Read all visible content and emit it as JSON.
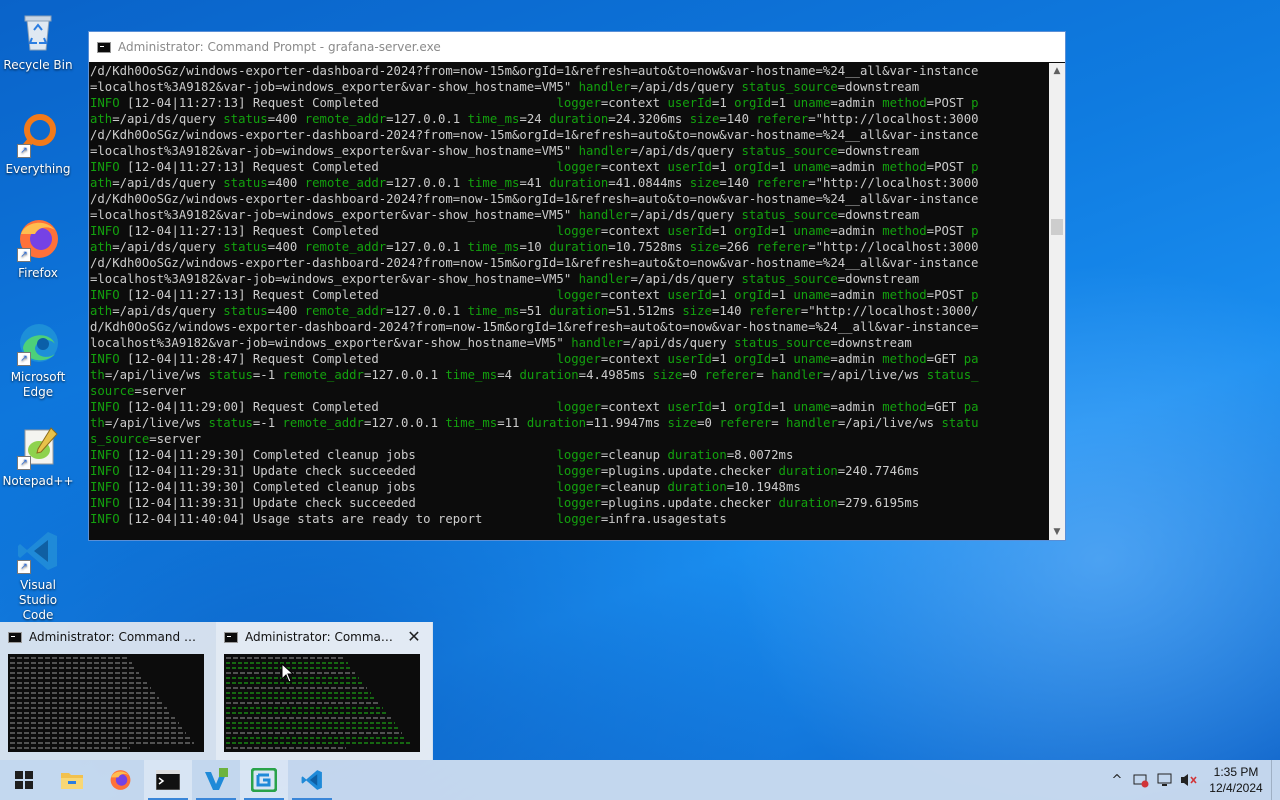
{
  "desktop": {
    "icons": [
      {
        "label": "Recycle Bin",
        "icon": "recycle-bin-icon"
      },
      {
        "label": "Everything",
        "icon": "search-magnifier-icon"
      },
      {
        "label": "Firefox",
        "icon": "firefox-icon"
      },
      {
        "label": "Microsoft Edge",
        "icon": "edge-icon"
      },
      {
        "label": "Notepad++",
        "icon": "notepadpp-icon"
      },
      {
        "label": "Visual Studio Code",
        "icon": "vscode-icon"
      }
    ]
  },
  "window": {
    "title": "Administrator: Command Prompt - grafana-server.exe",
    "console_lines": [
      [
        [
          "/d/Kdh0OoSGz/windows-exporter-dashboard-2024?from=now-15m&orgId=1&refresh=auto&to=now&var-hostname=%24__all&var-instance",
          "w"
        ]
      ],
      [
        [
          "=localhost%3A9182&var-job=windows_exporter&var-show_hostname=VM5\" ",
          "w"
        ],
        [
          "handler",
          "g"
        ],
        [
          "=/api/ds/query ",
          "w"
        ],
        [
          "status_source",
          "g"
        ],
        [
          "=downstream",
          "w"
        ]
      ],
      [
        [
          "INFO",
          "g"
        ],
        [
          " [12-04|11:27:13] Request Completed                        ",
          "w"
        ],
        [
          "logger",
          "g"
        ],
        [
          "=context ",
          "w"
        ],
        [
          "userId",
          "g"
        ],
        [
          "=1 ",
          "w"
        ],
        [
          "orgId",
          "g"
        ],
        [
          "=1 ",
          "w"
        ],
        [
          "uname",
          "g"
        ],
        [
          "=admin ",
          "w"
        ],
        [
          "method",
          "g"
        ],
        [
          "=POST ",
          "w"
        ],
        [
          "p",
          "g"
        ]
      ],
      [
        [
          "ath",
          "g"
        ],
        [
          "=/api/ds/query ",
          "w"
        ],
        [
          "status",
          "g"
        ],
        [
          "=400 ",
          "w"
        ],
        [
          "remote_addr",
          "g"
        ],
        [
          "=127.0.0.1 ",
          "w"
        ],
        [
          "time_ms",
          "g"
        ],
        [
          "=24 ",
          "w"
        ],
        [
          "duration",
          "g"
        ],
        [
          "=24.3206ms ",
          "w"
        ],
        [
          "size",
          "g"
        ],
        [
          "=140 ",
          "w"
        ],
        [
          "referer",
          "g"
        ],
        [
          "=\"http://localhost:3000",
          "w"
        ]
      ],
      [
        [
          "/d/Kdh0OoSGz/windows-exporter-dashboard-2024?from=now-15m&orgId=1&refresh=auto&to=now&var-hostname=%24__all&var-instance",
          "w"
        ]
      ],
      [
        [
          "=localhost%3A9182&var-job=windows_exporter&var-show_hostname=VM5\" ",
          "w"
        ],
        [
          "handler",
          "g"
        ],
        [
          "=/api/ds/query ",
          "w"
        ],
        [
          "status_source",
          "g"
        ],
        [
          "=downstream",
          "w"
        ]
      ],
      [
        [
          "INFO",
          "g"
        ],
        [
          " [12-04|11:27:13] Request Completed                        ",
          "w"
        ],
        [
          "logger",
          "g"
        ],
        [
          "=context ",
          "w"
        ],
        [
          "userId",
          "g"
        ],
        [
          "=1 ",
          "w"
        ],
        [
          "orgId",
          "g"
        ],
        [
          "=1 ",
          "w"
        ],
        [
          "uname",
          "g"
        ],
        [
          "=admin ",
          "w"
        ],
        [
          "method",
          "g"
        ],
        [
          "=POST ",
          "w"
        ],
        [
          "p",
          "g"
        ]
      ],
      [
        [
          "ath",
          "g"
        ],
        [
          "=/api/ds/query ",
          "w"
        ],
        [
          "status",
          "g"
        ],
        [
          "=400 ",
          "w"
        ],
        [
          "remote_addr",
          "g"
        ],
        [
          "=127.0.0.1 ",
          "w"
        ],
        [
          "time_ms",
          "g"
        ],
        [
          "=41 ",
          "w"
        ],
        [
          "duration",
          "g"
        ],
        [
          "=41.0844ms ",
          "w"
        ],
        [
          "size",
          "g"
        ],
        [
          "=140 ",
          "w"
        ],
        [
          "referer",
          "g"
        ],
        [
          "=\"http://localhost:3000",
          "w"
        ]
      ],
      [
        [
          "/d/Kdh0OoSGz/windows-exporter-dashboard-2024?from=now-15m&orgId=1&refresh=auto&to=now&var-hostname=%24__all&var-instance",
          "w"
        ]
      ],
      [
        [
          "=localhost%3A9182&var-job=windows_exporter&var-show_hostname=VM5\" ",
          "w"
        ],
        [
          "handler",
          "g"
        ],
        [
          "=/api/ds/query ",
          "w"
        ],
        [
          "status_source",
          "g"
        ],
        [
          "=downstream",
          "w"
        ]
      ],
      [
        [
          "INFO",
          "g"
        ],
        [
          " [12-04|11:27:13] Request Completed                        ",
          "w"
        ],
        [
          "logger",
          "g"
        ],
        [
          "=context ",
          "w"
        ],
        [
          "userId",
          "g"
        ],
        [
          "=1 ",
          "w"
        ],
        [
          "orgId",
          "g"
        ],
        [
          "=1 ",
          "w"
        ],
        [
          "uname",
          "g"
        ],
        [
          "=admin ",
          "w"
        ],
        [
          "method",
          "g"
        ],
        [
          "=POST ",
          "w"
        ],
        [
          "p",
          "g"
        ]
      ],
      [
        [
          "ath",
          "g"
        ],
        [
          "=/api/ds/query ",
          "w"
        ],
        [
          "status",
          "g"
        ],
        [
          "=400 ",
          "w"
        ],
        [
          "remote_addr",
          "g"
        ],
        [
          "=127.0.0.1 ",
          "w"
        ],
        [
          "time_ms",
          "g"
        ],
        [
          "=10 ",
          "w"
        ],
        [
          "duration",
          "g"
        ],
        [
          "=10.7528ms ",
          "w"
        ],
        [
          "size",
          "g"
        ],
        [
          "=266 ",
          "w"
        ],
        [
          "referer",
          "g"
        ],
        [
          "=\"http://localhost:3000",
          "w"
        ]
      ],
      [
        [
          "/d/Kdh0OoSGz/windows-exporter-dashboard-2024?from=now-15m&orgId=1&refresh=auto&to=now&var-hostname=%24__all&var-instance",
          "w"
        ]
      ],
      [
        [
          "=localhost%3A9182&var-job=windows_exporter&var-show_hostname=VM5\" ",
          "w"
        ],
        [
          "handler",
          "g"
        ],
        [
          "=/api/ds/query ",
          "w"
        ],
        [
          "status_source",
          "g"
        ],
        [
          "=downstream",
          "w"
        ]
      ],
      [
        [
          "INFO",
          "g"
        ],
        [
          " [12-04|11:27:13] Request Completed                        ",
          "w"
        ],
        [
          "logger",
          "g"
        ],
        [
          "=context ",
          "w"
        ],
        [
          "userId",
          "g"
        ],
        [
          "=1 ",
          "w"
        ],
        [
          "orgId",
          "g"
        ],
        [
          "=1 ",
          "w"
        ],
        [
          "uname",
          "g"
        ],
        [
          "=admin ",
          "w"
        ],
        [
          "method",
          "g"
        ],
        [
          "=POST ",
          "w"
        ],
        [
          "p",
          "g"
        ]
      ],
      [
        [
          "ath",
          "g"
        ],
        [
          "=/api/ds/query ",
          "w"
        ],
        [
          "status",
          "g"
        ],
        [
          "=400 ",
          "w"
        ],
        [
          "remote_addr",
          "g"
        ],
        [
          "=127.0.0.1 ",
          "w"
        ],
        [
          "time_ms",
          "g"
        ],
        [
          "=51 ",
          "w"
        ],
        [
          "duration",
          "g"
        ],
        [
          "=51.512ms ",
          "w"
        ],
        [
          "size",
          "g"
        ],
        [
          "=140 ",
          "w"
        ],
        [
          "referer",
          "g"
        ],
        [
          "=\"http://localhost:3000/",
          "w"
        ]
      ],
      [
        [
          "d/Kdh0OoSGz/windows-exporter-dashboard-2024?from=now-15m&orgId=1&refresh=auto&to=now&var-hostname=%24__all&var-instance=",
          "w"
        ]
      ],
      [
        [
          "localhost%3A9182&var-job=windows_exporter&var-show_hostname=VM5\" ",
          "w"
        ],
        [
          "handler",
          "g"
        ],
        [
          "=/api/ds/query ",
          "w"
        ],
        [
          "status_source",
          "g"
        ],
        [
          "=downstream",
          "w"
        ]
      ],
      [
        [
          "INFO",
          "g"
        ],
        [
          " [12-04|11:28:47] Request Completed                        ",
          "w"
        ],
        [
          "logger",
          "g"
        ],
        [
          "=context ",
          "w"
        ],
        [
          "userId",
          "g"
        ],
        [
          "=1 ",
          "w"
        ],
        [
          "orgId",
          "g"
        ],
        [
          "=1 ",
          "w"
        ],
        [
          "uname",
          "g"
        ],
        [
          "=admin ",
          "w"
        ],
        [
          "method",
          "g"
        ],
        [
          "=GET ",
          "w"
        ],
        [
          "pa",
          "g"
        ]
      ],
      [
        [
          "th",
          "g"
        ],
        [
          "=/api/live/ws ",
          "w"
        ],
        [
          "status",
          "g"
        ],
        [
          "=-1 ",
          "w"
        ],
        [
          "remote_addr",
          "g"
        ],
        [
          "=127.0.0.1 ",
          "w"
        ],
        [
          "time_ms",
          "g"
        ],
        [
          "=4 ",
          "w"
        ],
        [
          "duration",
          "g"
        ],
        [
          "=4.4985ms ",
          "w"
        ],
        [
          "size",
          "g"
        ],
        [
          "=0 ",
          "w"
        ],
        [
          "referer",
          "g"
        ],
        [
          "= ",
          "w"
        ],
        [
          "handler",
          "g"
        ],
        [
          "=/api/live/ws ",
          "w"
        ],
        [
          "status_",
          "g"
        ]
      ],
      [
        [
          "source",
          "g"
        ],
        [
          "=server",
          "w"
        ]
      ],
      [
        [
          "INFO",
          "g"
        ],
        [
          " [12-04|11:29:00] Request Completed                        ",
          "w"
        ],
        [
          "logger",
          "g"
        ],
        [
          "=context ",
          "w"
        ],
        [
          "userId",
          "g"
        ],
        [
          "=1 ",
          "w"
        ],
        [
          "orgId",
          "g"
        ],
        [
          "=1 ",
          "w"
        ],
        [
          "uname",
          "g"
        ],
        [
          "=admin ",
          "w"
        ],
        [
          "method",
          "g"
        ],
        [
          "=GET ",
          "w"
        ],
        [
          "pa",
          "g"
        ]
      ],
      [
        [
          "th",
          "g"
        ],
        [
          "=/api/live/ws ",
          "w"
        ],
        [
          "status",
          "g"
        ],
        [
          "=-1 ",
          "w"
        ],
        [
          "remote_addr",
          "g"
        ],
        [
          "=127.0.0.1 ",
          "w"
        ],
        [
          "time_ms",
          "g"
        ],
        [
          "=11 ",
          "w"
        ],
        [
          "duration",
          "g"
        ],
        [
          "=11.9947ms ",
          "w"
        ],
        [
          "size",
          "g"
        ],
        [
          "=0 ",
          "w"
        ],
        [
          "referer",
          "g"
        ],
        [
          "= ",
          "w"
        ],
        [
          "handler",
          "g"
        ],
        [
          "=/api/live/ws ",
          "w"
        ],
        [
          "statu",
          "g"
        ]
      ],
      [
        [
          "s_source",
          "g"
        ],
        [
          "=server",
          "w"
        ]
      ],
      [
        [
          "INFO",
          "g"
        ],
        [
          " [12-04|11:29:30] Completed cleanup jobs                   ",
          "w"
        ],
        [
          "logger",
          "g"
        ],
        [
          "=cleanup ",
          "w"
        ],
        [
          "duration",
          "g"
        ],
        [
          "=8.0072ms",
          "w"
        ]
      ],
      [
        [
          "INFO",
          "g"
        ],
        [
          " [12-04|11:29:31] Update check succeeded                   ",
          "w"
        ],
        [
          "logger",
          "g"
        ],
        [
          "=plugins.update.checker ",
          "w"
        ],
        [
          "duration",
          "g"
        ],
        [
          "=240.7746ms",
          "w"
        ]
      ],
      [
        [
          "INFO",
          "g"
        ],
        [
          " [12-04|11:39:30] Completed cleanup jobs                   ",
          "w"
        ],
        [
          "logger",
          "g"
        ],
        [
          "=cleanup ",
          "w"
        ],
        [
          "duration",
          "g"
        ],
        [
          "=10.1948ms",
          "w"
        ]
      ],
      [
        [
          "INFO",
          "g"
        ],
        [
          " [12-04|11:39:31] Update check succeeded                   ",
          "w"
        ],
        [
          "logger",
          "g"
        ],
        [
          "=plugins.update.checker ",
          "w"
        ],
        [
          "duration",
          "g"
        ],
        [
          "=279.6195ms",
          "w"
        ]
      ],
      [
        [
          "INFO",
          "g"
        ],
        [
          " [12-04|11:40:04] Usage stats are ready to report          ",
          "w"
        ],
        [
          "logger",
          "g"
        ],
        [
          "=infra.usagestats",
          "w"
        ]
      ]
    ],
    "scroll_up": "▲",
    "scroll_down": "▼"
  },
  "thumbnails": [
    {
      "title": "Administrator: Command Pro..."
    },
    {
      "title": "Administrator: Comman...",
      "close": "✕"
    }
  ],
  "taskbar": {
    "items": [
      "start-icon",
      "file-explorer-icon",
      "firefox-icon",
      "command-prompt-icon",
      "vs-installer-icon",
      "grafana-app-icon",
      "vscode-icon"
    ],
    "tray": {
      "chevron": "^",
      "time": "1:35 PM",
      "date": "12/4/2024"
    }
  },
  "colors": {
    "console_bg": "#0c0c0c",
    "console_text": "#cccccc",
    "console_green": "#13a10e",
    "accent": "#3a86d8"
  }
}
